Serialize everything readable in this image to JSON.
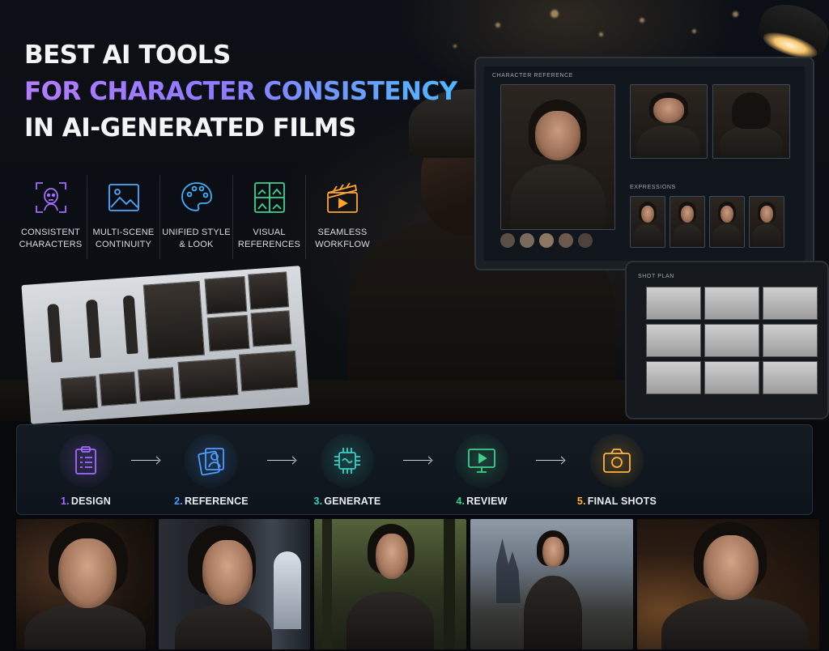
{
  "title": {
    "line1": "BEST AI TOOLS",
    "line2": "FOR CHARACTER CONSISTENCY",
    "line3": "IN AI-GENERATED FILMS"
  },
  "features": [
    {
      "icon": "face-scan-icon",
      "line1": "CONSISTENT",
      "line2": "CHARACTERS",
      "color": "#a46cff"
    },
    {
      "icon": "image-frame-icon",
      "line1": "MULTI-SCENE",
      "line2": "CONTINUITY",
      "color": "#4fa8ff"
    },
    {
      "icon": "palette-icon",
      "line1": "UNIFIED STYLE",
      "line2": "& LOOK",
      "color": "#3fb2ff"
    },
    {
      "icon": "grid-references-icon",
      "line1": "VISUAL",
      "line2": "REFERENCES",
      "color": "#3ed38f"
    },
    {
      "icon": "clapperboard-icon",
      "line1": "SEAMLESS",
      "line2": "WORKFLOW",
      "color": "#ffa531"
    }
  ],
  "monitor": {
    "reference_caption": "CHARACTER REFERENCE",
    "expressions_caption": "EXPRESSIONS",
    "swatches": [
      "#5a4e46",
      "#7a6a5e",
      "#8c7764",
      "#6b5a4c",
      "#4e433c"
    ]
  },
  "tablet": {
    "caption": "SHOT PLAN"
  },
  "workflow": [
    {
      "num": "1.",
      "label": "DESIGN",
      "icon": "clipboard-icon",
      "color": "#a36bff"
    },
    {
      "num": "2.",
      "label": "REFERENCE",
      "icon": "portrait-reference-icon",
      "color": "#4c9dff"
    },
    {
      "num": "3.",
      "label": "GENERATE",
      "icon": "chip-icon",
      "color": "#37d0c0"
    },
    {
      "num": "4.",
      "label": "REVIEW",
      "icon": "monitor-play-icon",
      "color": "#3fd08a"
    },
    {
      "num": "5.",
      "label": "FINAL SHOTS",
      "icon": "camera-icon",
      "color": "#ffb338"
    }
  ]
}
